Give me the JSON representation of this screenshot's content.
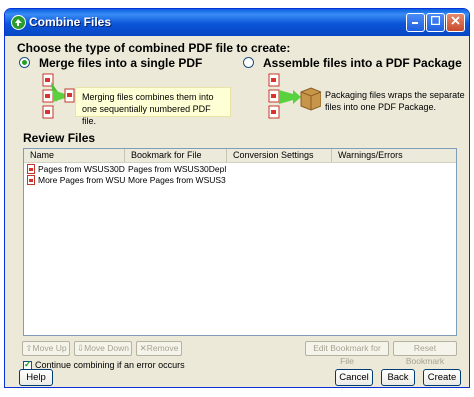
{
  "window": {
    "title": "Combine Files"
  },
  "header": {
    "heading": "Choose the type of combined PDF file to create:"
  },
  "options": {
    "merge": {
      "label": "Merge files into a single PDF",
      "description": "Merging files combines them into one sequentially numbered PDF file.",
      "selected": true
    },
    "assemble": {
      "label": "Assemble files into a PDF Package",
      "description": "Packaging files wraps the separate files into one PDF Package.",
      "selected": false
    }
  },
  "review": {
    "label": "Review Files",
    "columns": [
      "Name",
      "Bookmark for File",
      "Conversion Settings",
      "Warnings/Errors"
    ],
    "rows": [
      {
        "name": "Pages from WSUS30De...",
        "bookmark": "Pages from WSUS30Deplo...",
        "conversion": "",
        "warnings": ""
      },
      {
        "name": "More Pages from WSUS...",
        "bookmark": "More Pages from WSUS30...",
        "conversion": "",
        "warnings": ""
      }
    ]
  },
  "list_buttons": {
    "move_up": "Move Up",
    "move_down": "Move Down",
    "remove": "Remove",
    "edit_bookmark": "Edit Bookmark for File",
    "reset_bookmark": "Reset Bookmark"
  },
  "continue_option": {
    "label": "Continue combining if an error occurs",
    "checked": true
  },
  "footer": {
    "help": "Help",
    "cancel": "Cancel",
    "back": "Back",
    "create": "Create"
  },
  "colors": {
    "titlebar": "#0a55d8",
    "dialog_bg": "#ece9d8",
    "tooltip_bg": "#ffffd5",
    "radio_dot": "#21a121"
  }
}
